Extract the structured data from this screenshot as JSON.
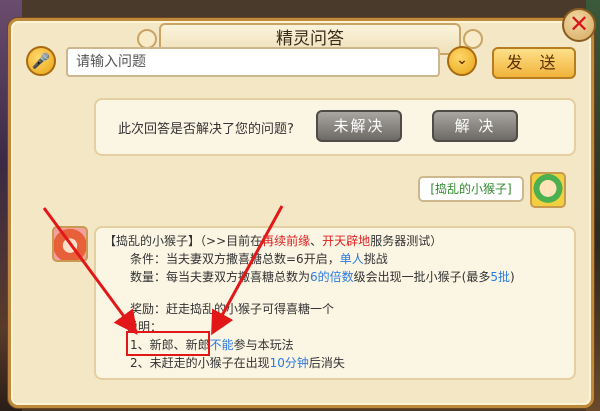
{
  "dialog": {
    "title": "精灵问答",
    "close_icon": "close-icon",
    "accent": "#c08a3c"
  },
  "search": {
    "placeholder": "请输入问题",
    "send_label": "发 送"
  },
  "feedback": {
    "question": "此次回答是否解决了您的问题?",
    "unsolved_label": "未解决",
    "solved_label": "解 决"
  },
  "user_message": {
    "text": "[捣乱的小猴子]"
  },
  "answer": {
    "head_name": "【捣乱的小猴子】",
    "head_a": "（>>目前在",
    "head_red1": "再续前缘",
    "head_b": "、",
    "head_red2": "开天辟地",
    "head_c": "服务器测试）",
    "cond_a": "条件：当夫妻双方撒喜糖总数=6开启，",
    "cond_blue": "单人",
    "cond_b": "挑战",
    "qty_a": "数量：每当夫妻双方撒喜糖总数为",
    "qty_blue1": "6的倍数",
    "qty_b": "级会出现一批小猴子(最多",
    "qty_blue2": "5批",
    "qty_c": ")",
    "reward": "奖励：赶走捣乱的小猴子可得喜糖一个",
    "note_label": "说明：",
    "note1_a": "1、新郎、新郎",
    "note1_blue": "不能",
    "note1_b": "参与本玩法",
    "note2_a": "2、未赶走的小猴子在出现",
    "note2_blue": "10分钟",
    "note2_b": "后消失"
  },
  "colors": {
    "highlight": "#e21818",
    "link_blue": "#2a7ae2",
    "emphasis_red": "#e02020"
  }
}
